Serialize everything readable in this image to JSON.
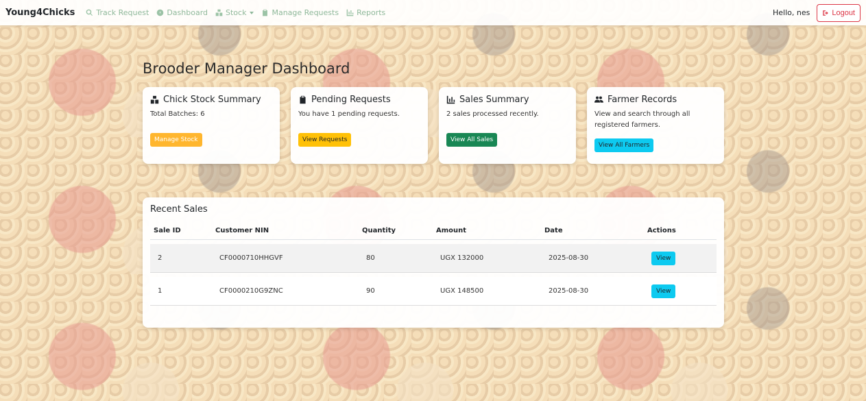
{
  "nav": {
    "brand": "Young4Chicks",
    "links": [
      {
        "label": "Track Request",
        "icon": "search-icon"
      },
      {
        "label": "Dashboard",
        "icon": "dashboard-icon"
      },
      {
        "label": "Stock",
        "icon": "boxes-icon"
      },
      {
        "label": "Manage Requests",
        "icon": "clipboard-icon"
      },
      {
        "label": "Reports",
        "icon": "chart-icon"
      }
    ],
    "greeting": "Hello, nes",
    "logout_label": "Logout"
  },
  "page": {
    "title": "Brooder Manager Dashboard"
  },
  "cards": [
    {
      "title": "Chick Stock Summary",
      "text": "Total Batches: 6",
      "button": "Manage Stock",
      "icon": "boxes-icon"
    },
    {
      "title": "Pending Requests",
      "text": "You have 1 pending requests.",
      "button": "View Requests",
      "icon": "clipboard-icon"
    },
    {
      "title": "Sales Summary",
      "text": "2 sales processed recently.",
      "button": "View All Sales",
      "icon": "chart-icon"
    },
    {
      "title": "Farmer Records",
      "text": "View and search through all registered farmers.",
      "button": "View All Farmers",
      "icon": "users-icon"
    }
  ],
  "recent_sales": {
    "title": "Recent Sales",
    "columns": [
      "Sale ID",
      "Customer NIN",
      "Quantity",
      "Amount",
      "Date",
      "Actions"
    ],
    "rows": [
      {
        "id": "2",
        "nin": "CF0000710HHGVF",
        "quantity": "80",
        "amount": "UGX 132000",
        "date": "2025-08-30",
        "action": "View"
      },
      {
        "id": "1",
        "nin": "CF0000210G9ZNC",
        "quantity": "90",
        "amount": "UGX 148500",
        "date": "2025-08-30",
        "action": "View"
      }
    ]
  },
  "colors": {
    "accent_green": "#198754",
    "warning": "#ffc107",
    "info": "#0dcaf0",
    "danger": "#dc3545"
  }
}
